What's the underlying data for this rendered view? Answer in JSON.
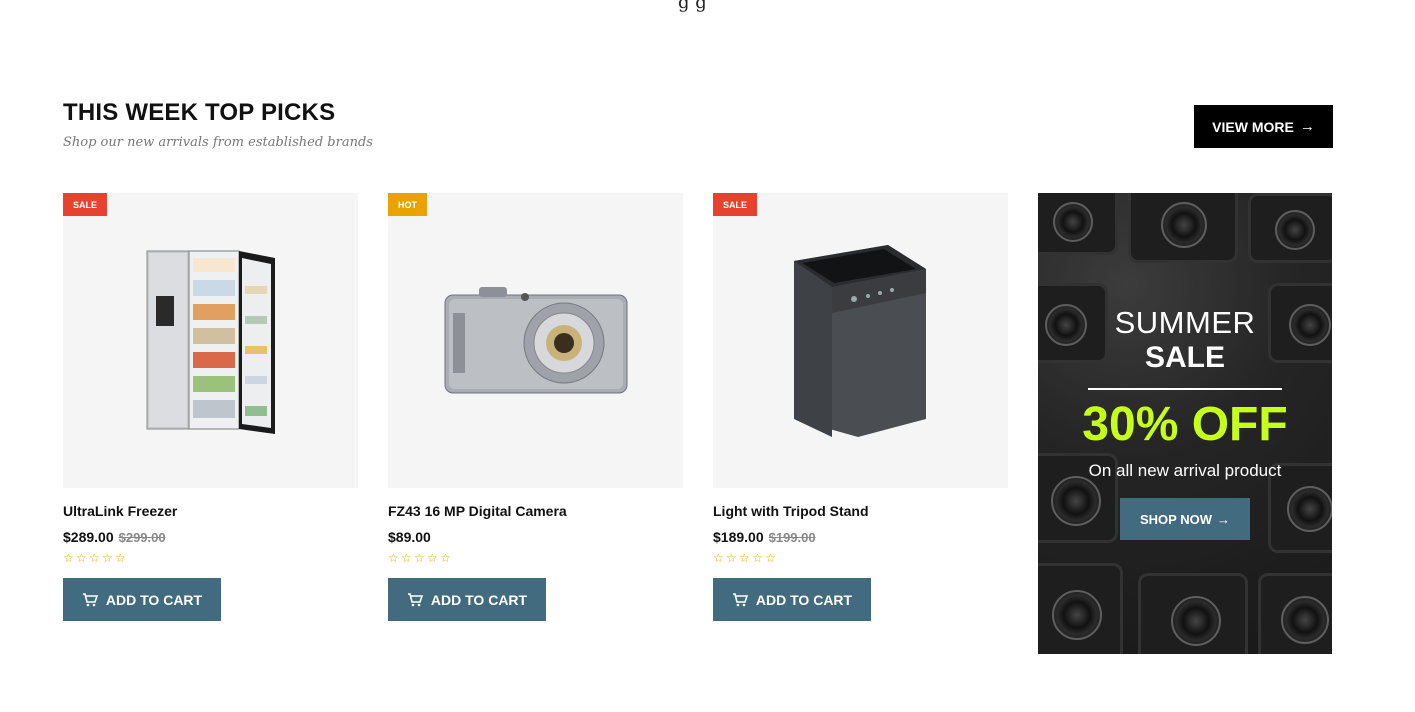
{
  "top_glyph": "g g",
  "section": {
    "title": "THIS WEEK TOP PICKS",
    "subtitle": "Shop our new arrivals from established brands",
    "view_more_label": "VIEW MORE"
  },
  "products": [
    {
      "badge": "SALE",
      "name": "UltraLink Freezer",
      "price": "$289.00",
      "old_price": "$299.00",
      "rating": 0,
      "cart_label": "ADD TO CART",
      "icon": "refrigerator-image"
    },
    {
      "badge": "HOT",
      "name": "FZ43 16 MP Digital Camera",
      "price": "$89.00",
      "old_price": "",
      "rating": 0,
      "cart_label": "ADD TO CART",
      "icon": "camera-image"
    },
    {
      "badge": "SALE",
      "name": "Light with Tripod Stand",
      "price": "$189.00",
      "old_price": "$199.00",
      "rating": 0,
      "cart_label": "ADD TO CART",
      "icon": "washing-machine-image"
    }
  ],
  "promo": {
    "line1": "SUMMER",
    "line2": "SALE",
    "discount": "30% OFF",
    "description": "On all new arrival product",
    "button_label": "SHOP NOW"
  },
  "colors": {
    "accent": "#426b80",
    "sale_badge": "#e8412f",
    "hot_badge": "#e8a300",
    "promo_highlight": "#c6ff1a",
    "star": "#e8a300"
  }
}
